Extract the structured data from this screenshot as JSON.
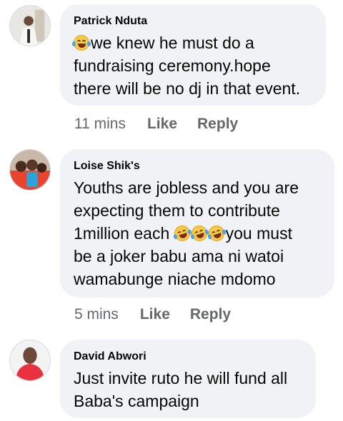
{
  "comments": [
    {
      "author": "Patrick Nduta",
      "lines": [
        "we knew he must do a",
        "fundraising ceremony.hope",
        "there will be no dj in that event."
      ],
      "time": "11 mins",
      "like": "Like",
      "reply": "Reply",
      "emoji": "face-with-tears-of-joy"
    },
    {
      "author": "Loise Shik's",
      "lines": [
        "Youths are jobless and you are",
        "expecting them to contribute",
        "1million each",
        "be a joker babu ama ni watoi",
        "wamabunge niache mdomo"
      ],
      "line3_tail": "you must",
      "time": "5 mins",
      "like": "Like",
      "reply": "Reply",
      "emoji": "rolling-on-floor-laughing"
    },
    {
      "author": "David Abwori",
      "lines": [
        "Just invite ruto he will fund all",
        "Baba's campaign"
      ]
    }
  ],
  "colors": {
    "bubble": "#f0f2f5",
    "meta": "#65676b",
    "text": "#050505"
  }
}
